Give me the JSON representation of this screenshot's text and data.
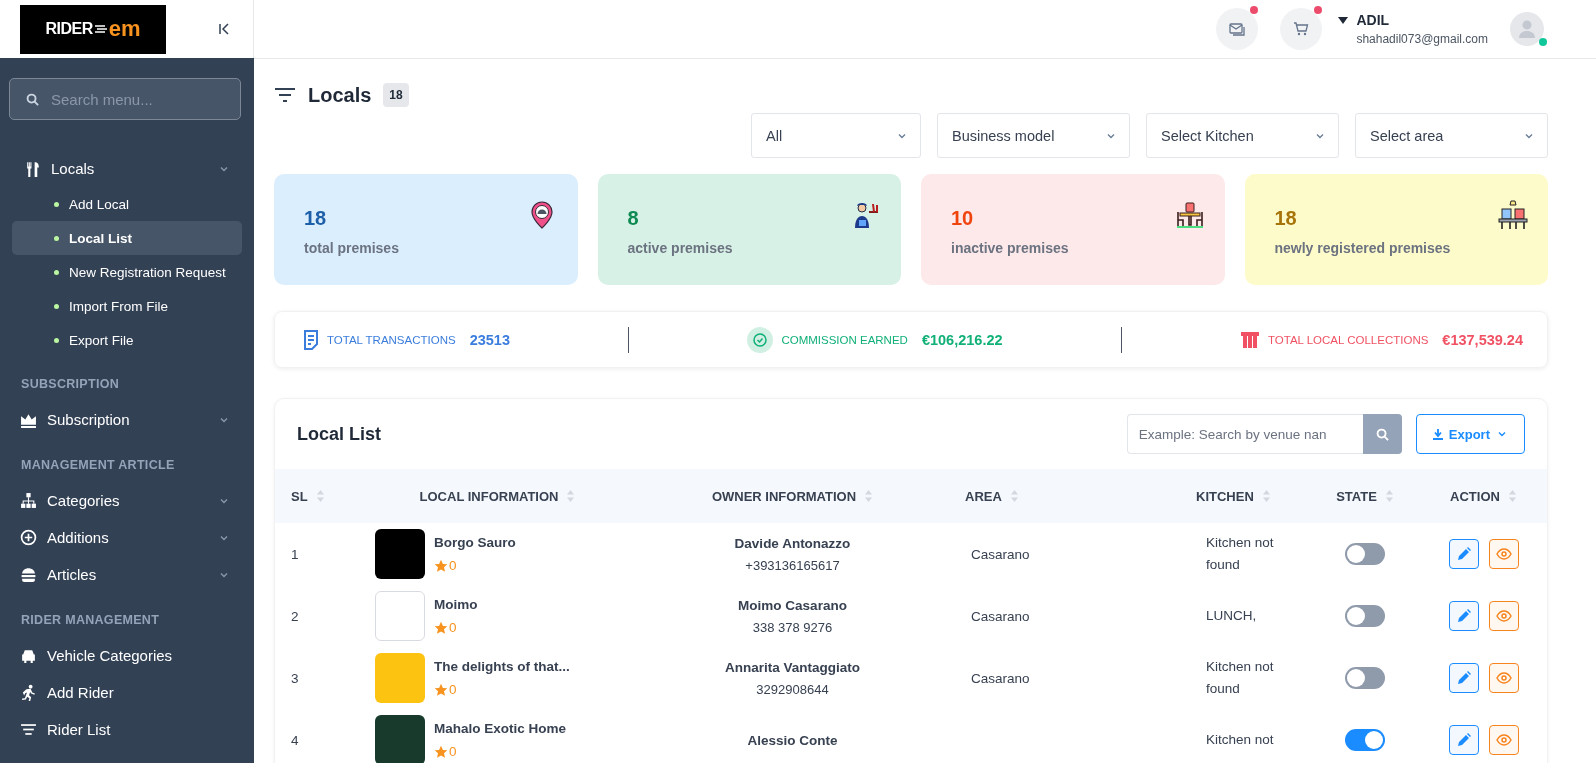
{
  "logo": {
    "text": "RIDER",
    "accent": "em"
  },
  "sidebar": {
    "search_placeholder": "Search menu...",
    "groups": [
      {
        "items": [
          {
            "label": "Locals",
            "has_submenu": true,
            "children": [
              {
                "label": "Add Local",
                "selected": false
              },
              {
                "label": "Local List",
                "selected": true
              },
              {
                "label": "New Registration Request",
                "selected": false
              },
              {
                "label": "Import From File",
                "selected": false
              },
              {
                "label": "Export File",
                "selected": false
              }
            ]
          }
        ]
      },
      {
        "heading": "SUBSCRIPTION",
        "items": [
          {
            "label": "Subscription",
            "has_submenu": true
          }
        ]
      },
      {
        "heading": "MANAGEMENT ARTICLE",
        "items": [
          {
            "label": "Categories",
            "has_submenu": true
          },
          {
            "label": "Additions",
            "has_submenu": true
          },
          {
            "label": "Articles",
            "has_submenu": true
          }
        ]
      },
      {
        "heading": "RIDER MANAGEMENT",
        "items": [
          {
            "label": "Vehicle Categories",
            "has_submenu": false
          },
          {
            "label": "Add Rider",
            "has_submenu": false
          },
          {
            "label": "Rider List",
            "has_submenu": false
          }
        ]
      }
    ]
  },
  "topbar": {
    "user_name": "ADIL",
    "email": "shahadil073@gmail.com",
    "online": true,
    "messages_unread": true,
    "cart_unread": true
  },
  "page": {
    "title": "Locals",
    "count": "18"
  },
  "filters": [
    "All",
    "Business model",
    "Select Kitchen",
    "Select area"
  ],
  "stats": [
    {
      "value": "18",
      "label": "total premises",
      "color": "#1d5fa8"
    },
    {
      "value": "8",
      "label": "active premises",
      "color": "#0f8a52"
    },
    {
      "value": "10",
      "label": "inactive premises",
      "color": "#f0440f"
    },
    {
      "value": "18",
      "label": "newly registered premises",
      "color": "#a7740a"
    }
  ],
  "summary": [
    {
      "label": "TOTAL TRANSACTIONS",
      "value": "23513",
      "color": "#3b7ddd"
    },
    {
      "label": "COMMISSION EARNED",
      "value": "€106,216.22",
      "color": "#10b077"
    },
    {
      "label": "TOTAL LOCAL COLLECTIONS",
      "value": "€137,539.24",
      "color": "#f05264"
    }
  ],
  "table": {
    "title": "Local List",
    "search_placeholder": "Example: Search by venue nan",
    "export_label": "Export",
    "columns": [
      "SL",
      "LOCAL INFORMATION",
      "OWNER INFORMATION",
      "AREA",
      "KITCHEN",
      "STATE",
      "ACTION"
    ],
    "rows": [
      {
        "sl": "1",
        "name": "Borgo Sauro",
        "rating": "0",
        "owner": "Davide Antonazzo",
        "phone": "+393136165617",
        "area": "Casarano",
        "kitchen": "Kitchen not found",
        "on": false
      },
      {
        "sl": "2",
        "name": "Moimo",
        "rating": "0",
        "owner": "Moimo Casarano",
        "phone": "338 378 9276",
        "area": "Casarano",
        "kitchen": "LUNCH,",
        "on": false
      },
      {
        "sl": "3",
        "name": "The delights of that...",
        "rating": "0",
        "owner": "Annarita Vantaggiato",
        "phone": "3292908644",
        "area": "Casarano",
        "kitchen": "Kitchen not found",
        "on": false
      },
      {
        "sl": "4",
        "name": "Mahalo Exotic Home",
        "rating": "0",
        "owner": "Alessio Conte",
        "phone": "",
        "area": "",
        "kitchen": "Kitchen not",
        "on": true
      }
    ]
  }
}
